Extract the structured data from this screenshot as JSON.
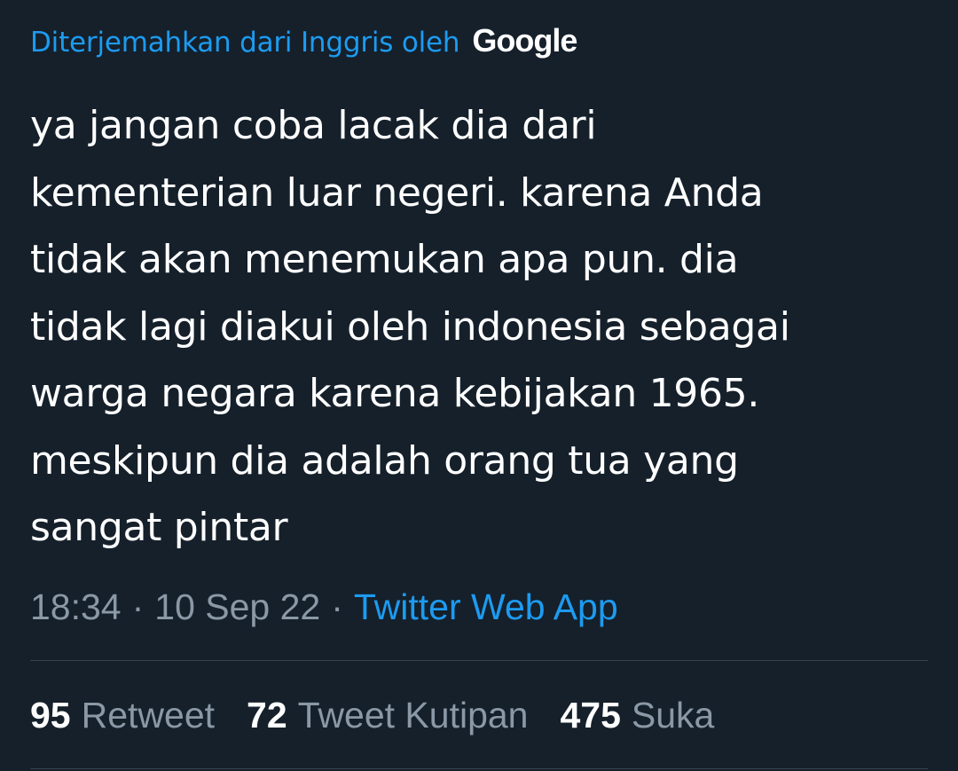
{
  "translation": {
    "label": "Diterjemahkan dari Inggris oleh",
    "provider": "Google"
  },
  "tweet": {
    "text": "ya jangan coba lacak dia dari\nkementerian luar negeri. karena Anda\ntidak akan menemukan apa pun. dia\ntidak lagi diakui oleh indonesia sebagai\nwarga negara karena kebijakan 1965.\nmeskipun dia adalah orang tua yang\nsangat pintar"
  },
  "meta": {
    "time": "18:34",
    "separator": "·",
    "date": "10 Sep 22",
    "source": "Twitter Web App"
  },
  "stats": [
    {
      "count": "95",
      "label": "Retweet"
    },
    {
      "count": "72",
      "label": "Tweet Kutipan"
    },
    {
      "count": "475",
      "label": "Suka"
    }
  ],
  "colors": {
    "background": "#15202b",
    "accent": "#1d9bf0",
    "secondary_text": "#8b98a5",
    "divider": "#38444d"
  }
}
